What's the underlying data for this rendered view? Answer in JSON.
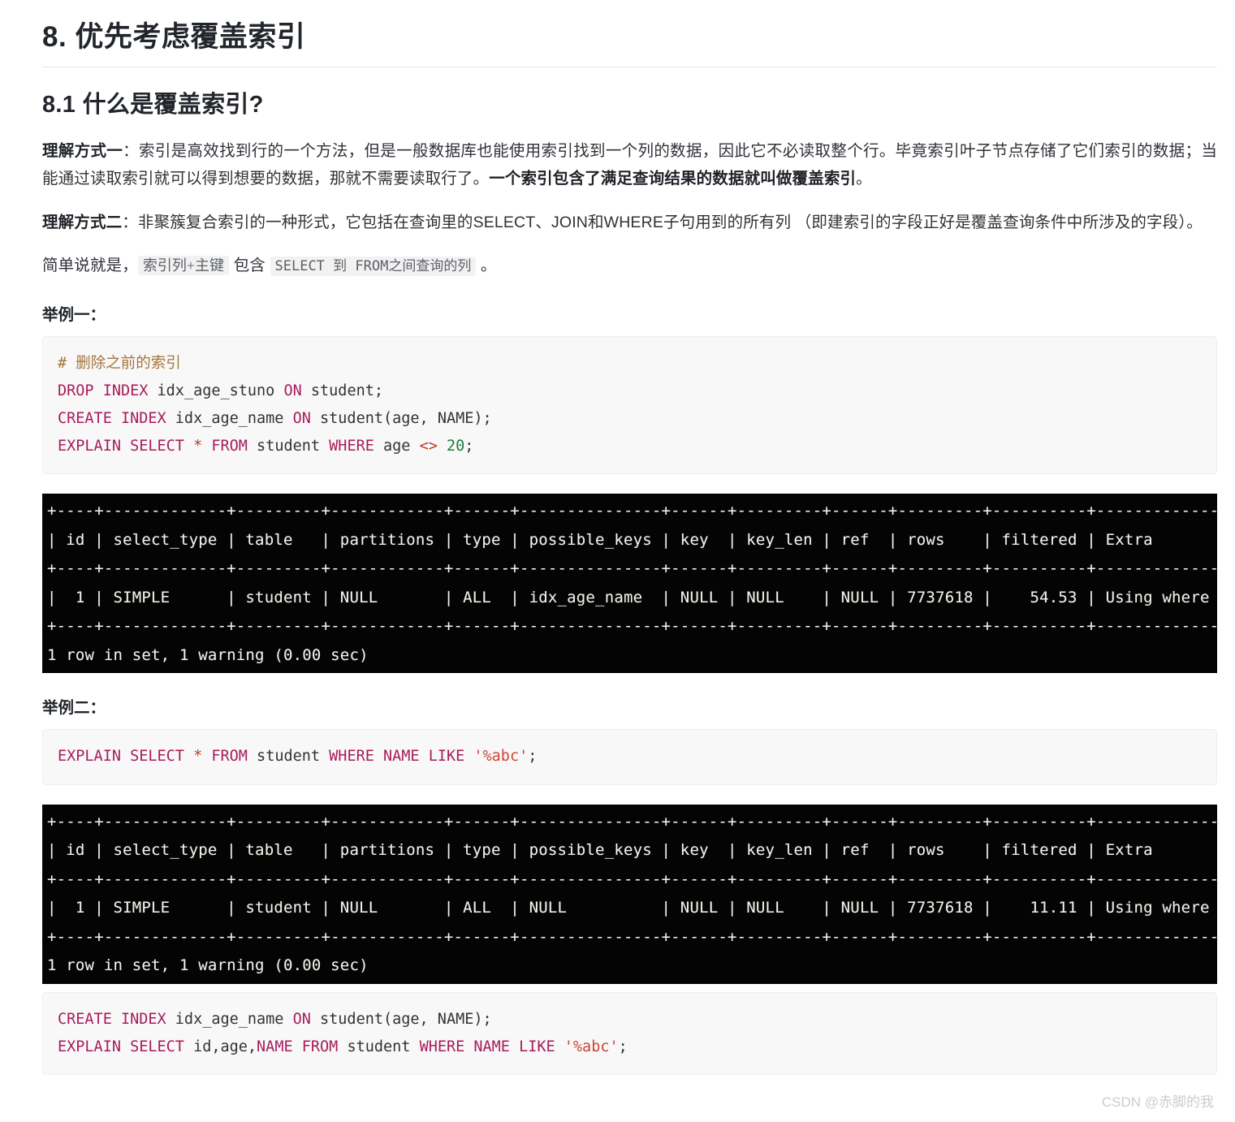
{
  "heading": {
    "h1": "8. 优先考虑覆盖索引",
    "h2": "8.1 什么是覆盖索引?"
  },
  "paragraphs": {
    "p1": {
      "lead": "理解方式一",
      "colon": "：",
      "body_a": "索引是高效找到行的一个方法，但是一般数据库也能使用索引找到一个列的数据，因此它不必读取整个行。毕竟索引叶子节点存储了它们索引的数据；当能通过读取索引就可以得到想要的数据，那就不需要读取行了。",
      "bold_tail": "一个索引包含了满足查询结果的数据就叫做覆盖索引",
      "end": "。"
    },
    "p2": {
      "lead": "理解方式二",
      "colon": "：",
      "body": "非聚簇复合索引的一种形式，它包括在查询里的SELECT、JOIN和WHERE子句用到的所有列 （即建索引的字段正好是覆盖查询条件中所涉及的字段）。"
    },
    "p3": {
      "prefix": "简单说就是，",
      "code1": "索引列+主键",
      "mid": " 包含 ",
      "code2": "SELECT 到 FROM之间查询的列",
      "suffix": " 。"
    }
  },
  "labels": {
    "example_one": "举例一：",
    "example_two": "举例二："
  },
  "code_block_1": {
    "lines": [
      {
        "tokens": [
          {
            "t": "# 删除之前的索引",
            "c": "cmt"
          }
        ]
      },
      {
        "tokens": [
          {
            "t": "DROP INDEX",
            "c": "kw"
          },
          {
            "t": " idx_age_stuno ",
            "c": "pl"
          },
          {
            "t": "ON",
            "c": "kw"
          },
          {
            "t": " student;",
            "c": "pl"
          }
        ]
      },
      {
        "tokens": [
          {
            "t": "CREATE INDEX",
            "c": "kw"
          },
          {
            "t": " idx_age_name ",
            "c": "pl"
          },
          {
            "t": "ON",
            "c": "kw"
          },
          {
            "t": " student(age, ",
            "c": "pl"
          },
          {
            "t": "NAME",
            "c": "pl"
          },
          {
            "t": ");",
            "c": "pl"
          }
        ]
      },
      {
        "tokens": [
          {
            "t": "EXPLAIN SELECT",
            "c": "kw"
          },
          {
            "t": " * ",
            "c": "op"
          },
          {
            "t": "FROM",
            "c": "kw"
          },
          {
            "t": " student ",
            "c": "pl"
          },
          {
            "t": "WHERE",
            "c": "kw"
          },
          {
            "t": " age ",
            "c": "pl"
          },
          {
            "t": "<>",
            "c": "op"
          },
          {
            "t": " ",
            "c": "pl"
          },
          {
            "t": "20",
            "c": "num"
          },
          {
            "t": ";",
            "c": "pl"
          }
        ]
      }
    ]
  },
  "terminal_1": {
    "lines": [
      "+----+-------------+---------+------------+------+---------------+------+---------+------+---------+----------+-------------+",
      "| id | select_type | table   | partitions | type | possible_keys | key  | key_len | ref  | rows    | filtered | Extra       |",
      "+----+-------------+---------+------------+------+---------------+------+---------+------+---------+----------+-------------+",
      "|  1 | SIMPLE      | student | NULL       | ALL  | idx_age_name  | NULL | NULL    | NULL | 7737618 |    54.53 | Using where |",
      "+----+-------------+---------+------------+------+---------------+------+---------+------+---------+----------+-------------+",
      "1 row in set, 1 warning (0.00 sec)"
    ],
    "columns": [
      "id",
      "select_type",
      "table",
      "partitions",
      "type",
      "possible_keys",
      "key",
      "key_len",
      "ref",
      "rows",
      "filtered",
      "Extra"
    ],
    "row": [
      "1",
      "SIMPLE",
      "student",
      "NULL",
      "ALL",
      "idx_age_name",
      "NULL",
      "NULL",
      "NULL",
      "7737618",
      "54.53",
      "Using where"
    ],
    "status": "1 row in set, 1 warning (0.00 sec)"
  },
  "code_block_2": {
    "lines": [
      {
        "tokens": [
          {
            "t": "EXPLAIN SELECT",
            "c": "kw"
          },
          {
            "t": " * ",
            "c": "op"
          },
          {
            "t": "FROM",
            "c": "kw"
          },
          {
            "t": " student ",
            "c": "pl"
          },
          {
            "t": "WHERE NAME LIKE",
            "c": "kw"
          },
          {
            "t": " ",
            "c": "pl"
          },
          {
            "t": "'%abc'",
            "c": "str"
          },
          {
            "t": ";",
            "c": "pl"
          }
        ]
      }
    ]
  },
  "terminal_2": {
    "lines": [
      "+----+-------------+---------+------------+------+---------------+------+---------+------+---------+----------+-------------+",
      "| id | select_type | table   | partitions | type | possible_keys | key  | key_len | ref  | rows    | filtered | Extra       |",
      "+----+-------------+---------+------------+------+---------------+------+---------+------+---------+----------+-------------+",
      "|  1 | SIMPLE      | student | NULL       | ALL  | NULL          | NULL | NULL    | NULL | 7737618 |    11.11 | Using where |",
      "+----+-------------+---------+------------+------+---------------+------+---------+------+---------+----------+-------------+",
      "1 row in set, 1 warning (0.00 sec)"
    ],
    "columns": [
      "id",
      "select_type",
      "table",
      "partitions",
      "type",
      "possible_keys",
      "key",
      "key_len",
      "ref",
      "rows",
      "filtered",
      "Extra"
    ],
    "row": [
      "1",
      "SIMPLE",
      "student",
      "NULL",
      "ALL",
      "NULL",
      "NULL",
      "NULL",
      "NULL",
      "7737618",
      "11.11",
      "Using where"
    ],
    "status": "1 row in set, 1 warning (0.00 sec)"
  },
  "code_block_3": {
    "lines": [
      {
        "tokens": [
          {
            "t": "CREATE INDEX",
            "c": "kw"
          },
          {
            "t": " idx_age_name ",
            "c": "pl"
          },
          {
            "t": "ON",
            "c": "kw"
          },
          {
            "t": " student(age, NAME);",
            "c": "pl"
          }
        ]
      },
      {
        "tokens": [
          {
            "t": "EXPLAIN SELECT",
            "c": "kw"
          },
          {
            "t": " id,age,",
            "c": "pl"
          },
          {
            "t": "NAME",
            "c": "kw"
          },
          {
            "t": " ",
            "c": "pl"
          },
          {
            "t": "FROM",
            "c": "kw"
          },
          {
            "t": " student ",
            "c": "pl"
          },
          {
            "t": "WHERE NAME LIKE",
            "c": "kw"
          },
          {
            "t": " ",
            "c": "pl"
          },
          {
            "t": "'%abc'",
            "c": "str"
          },
          {
            "t": ";",
            "c": "pl"
          }
        ]
      }
    ]
  },
  "watermark": "CSDN @赤脚的我",
  "colors": {
    "keyword": "#a71d5d",
    "comment": "#a6753c",
    "string": "#d14437",
    "number": "#1d7d3f",
    "operator": "#c0392b",
    "code_bg": "#f8f8f8",
    "terminal_bg": "#040404",
    "terminal_fg": "#f3f3ec",
    "text": "#2f3237"
  }
}
